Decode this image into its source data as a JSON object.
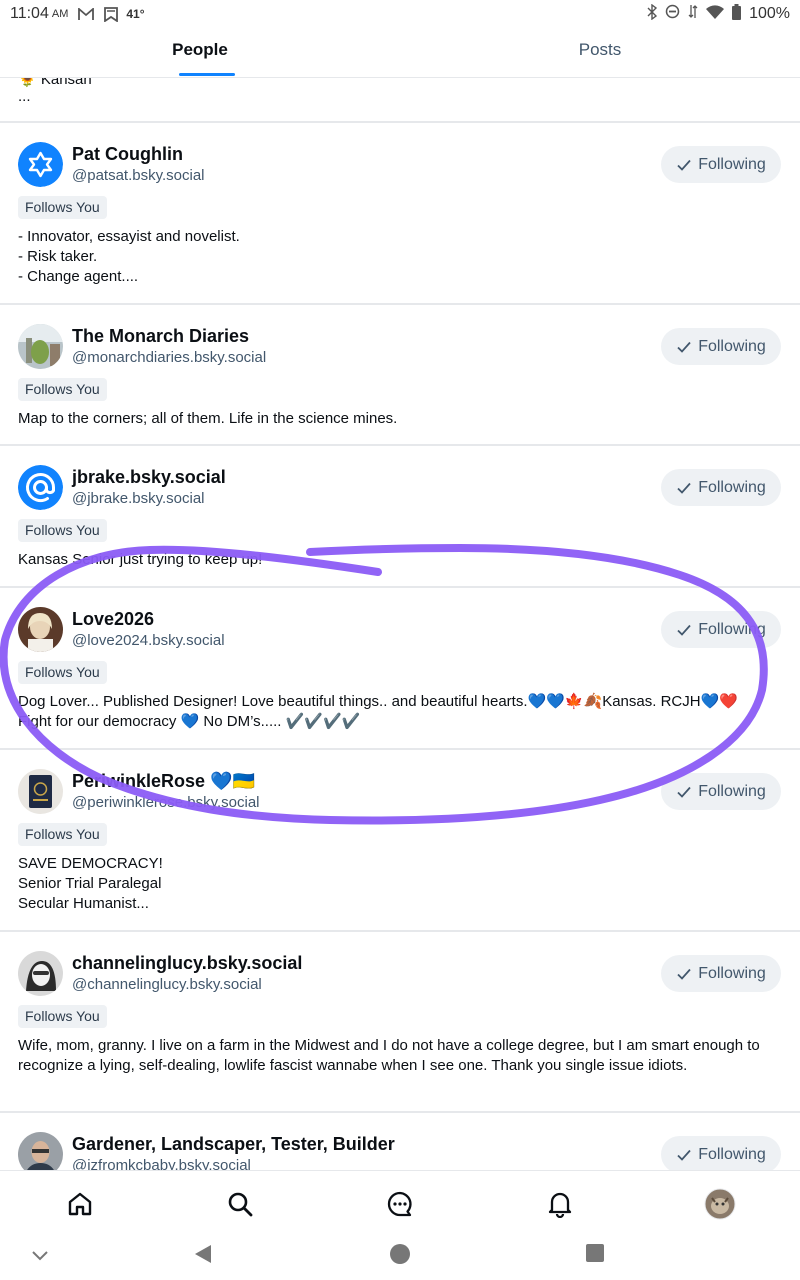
{
  "status_bar": {
    "time": "11:04",
    "ampm": "AM",
    "temperature": "41°",
    "battery": "100%"
  },
  "tabs": [
    {
      "label": "People",
      "active": true
    },
    {
      "label": "Posts",
      "active": false
    }
  ],
  "partial_card": {
    "line1": "🌻 Kansan",
    "line2": "..."
  },
  "people": [
    {
      "name": "Pat Coughlin",
      "handle": "@patsat.bsky.social",
      "badge": "Follows You",
      "button": "Following",
      "bio": "- Innovator, essayist and novelist.\n- Risk taker.\n- Change agent....",
      "avatar": "blue-star-avatar"
    },
    {
      "name": "The Monarch Diaries",
      "handle": "@monarchdiaries.bsky.social",
      "badge": "Follows You",
      "button": "Following",
      "bio": "Map to the corners; all of them.  Life in the science mines.",
      "avatar": "photo-avatar"
    },
    {
      "name": "jbrake.bsky.social",
      "handle": "@jbrake.bsky.social",
      "badge": "Follows You",
      "button": "Following",
      "bio": "Kansas Senior just trying to keep up!",
      "avatar": "default-at-avatar"
    },
    {
      "name": "Love2026",
      "handle": "@love2024.bsky.social",
      "badge": "Follows You",
      "button": "Following",
      "bio": "Dog Lover... Published Designer! Love beautiful things.. and beautiful hearts.💙💙🍁🍂Kansas. RCJH💙❤️\nFight for our democracy 💙 No DM’s..... ✔️✔️✔️✔️",
      "avatar": "photo-avatar"
    },
    {
      "name": "PeriwinkleRose 💙🇺🇦",
      "handle": "@periwinklerose.bsky.social",
      "badge": "Follows You",
      "button": "Following",
      "bio": "SAVE DEMOCRACY!\nSenior Trial Paralegal\nSecular Humanist...",
      "avatar": "passport-avatar"
    },
    {
      "name": "channelinglucy.bsky.social",
      "handle": "@channelinglucy.bsky.social",
      "badge": "Follows You",
      "button": "Following",
      "bio": "Wife, mom, granny. I live on a farm in the Midwest and I do not have a college degree, but I am smart enough to recognize a lying, self-dealing, lowlife fascist wannabe when I see one. Thank you single issue idiots.",
      "avatar": "photo-avatar"
    },
    {
      "name": "Gardener, Landscaper, Tester, Builder",
      "handle": "@jzfromkcbaby.bsky.social",
      "badge": "",
      "button": "Following",
      "bio": "",
      "avatar": "photo-avatar"
    }
  ],
  "colors": {
    "accent": "#1083fe",
    "annotation": "#8b5cf6",
    "button_bg": "#eef1f4"
  },
  "bottom_nav": [
    "home-icon",
    "search-icon",
    "chat-icon",
    "notifications-icon",
    "profile-avatar"
  ]
}
